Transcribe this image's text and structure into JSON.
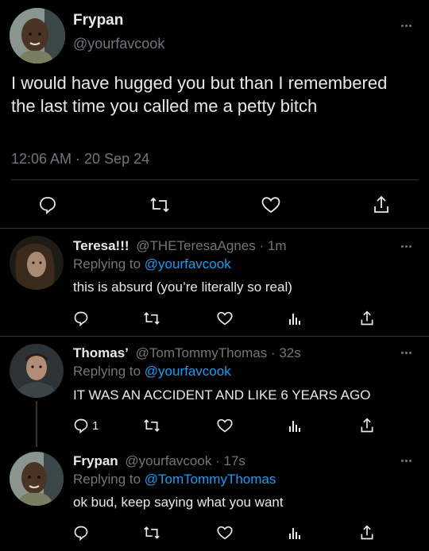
{
  "main_tweet": {
    "display_name": "Frypan",
    "handle": "@yourfavcook",
    "text": "I would have hugged you but than I remembered the last time you called me a petty bitch",
    "timestamp": "12:06 AM · 20 Sep 24",
    "actions": [
      "reply-icon",
      "retweet-icon",
      "like-icon",
      "share-icon"
    ]
  },
  "replies": [
    {
      "display_name": "Teresa!!!",
      "handle": "@THETeresaAgnes",
      "time": "1m",
      "replying_label": "Replying to",
      "replying_to": "@yourfavcook",
      "text": "this is absurd (you’re literally so real)",
      "reply_count": ""
    },
    {
      "display_name": "Thomas’",
      "handle": "@TomTommyThomas",
      "time": "32s",
      "replying_label": "Replying to",
      "replying_to": "@yourfavcook",
      "text": "IT WAS AN ACCIDENT AND LIKE 6 YEARS AGO",
      "reply_count": "1"
    },
    {
      "display_name": "Frypan",
      "handle": "@yourfavcook",
      "time": "17s",
      "replying_label": "Replying to",
      "replying_to": "@TomTommyThomas",
      "text": "ok bud, keep saying what you want",
      "reply_count": ""
    }
  ],
  "separator": "·",
  "colors": {
    "background": "#000000",
    "text": "#e7e9ea",
    "muted": "#71767b",
    "link": "#1d9bf0",
    "divider": "#2f3336"
  }
}
